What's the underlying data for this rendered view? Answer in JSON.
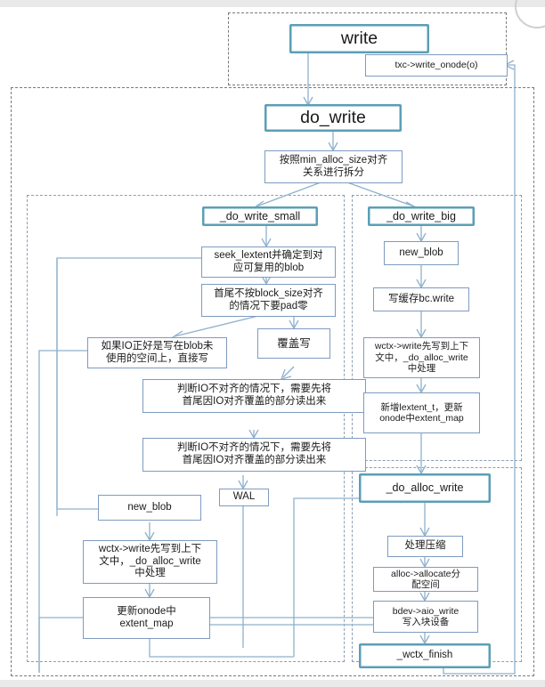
{
  "diagram": {
    "title_nodes": {
      "write": "write",
      "do_write": "do_write",
      "do_write_small": "_do_write_small",
      "do_write_big": "_do_write_big",
      "do_alloc_write": "_do_alloc_write",
      "wctx_finish": "_wctx_finish"
    },
    "nodes": {
      "write": "write",
      "txc_write_onode": "txc->write_onode(o)",
      "do_write": "do_write",
      "split": "按照min_alloc_size对齐\n关系进行拆分",
      "split_l1": "按照min_alloc_size对齐",
      "split_l2": "关系进行拆分",
      "do_write_small": "_do_write_small",
      "seek_lextent_l1": "seek_lextent并确定到对",
      "seek_lextent_l2": "应可复用的blob",
      "pad_zero_l1": "首尾不按block_size对齐",
      "pad_zero_l2": "的情况下要pad零",
      "unused_space_l1": "如果IO正好是写在blob未",
      "unused_space_l2": "使用的空间上，直接写",
      "overwrite": "覆盖写",
      "unaligned_a_l1": "判断IO不对齐的情况下，需要先将",
      "unaligned_a_l2": "首尾因IO对齐覆盖的部分读出来",
      "unaligned_b_l1": "判断IO不对齐的情况下，需要先将",
      "unaligned_b_l2": "首尾因IO对齐覆盖的部分读出来",
      "new_blob_small": "new_blob",
      "wal": "WAL",
      "wctx_write_small_l1": "wctx->write先写到上下",
      "wctx_write_small_l2": "文中，_do_alloc_write",
      "wctx_write_small_l3": "中处理",
      "update_onode_l1": "更新onode中",
      "update_onode_l2": "extent_map",
      "do_write_big": "_do_write_big",
      "new_blob_big": "new_blob",
      "bc_write": "写缓存bc.write",
      "wctx_write_big_l1": "wctx->write先写到上下",
      "wctx_write_big_l2": "文中，_do_alloc_write",
      "wctx_write_big_l3": "中处理",
      "new_lextent_l1": "新增lextent_t，更新",
      "new_lextent_l2": "onode中extent_map",
      "do_alloc_write": "_do_alloc_write",
      "compress": "处理压缩",
      "allocate_l1": "alloc->allocate分",
      "allocate_l2": "配空间",
      "aio_write_l1": "bdev->aio_write",
      "aio_write_l2": "写入块设备",
      "wctx_finish": "_wctx_finish"
    },
    "colors": {
      "accent_border": "#5b9fb5",
      "node_border": "#7f9bbf",
      "connector": "#8fb0cc",
      "group_border": "#7a7a7a",
      "inner_group_border": "#8a9fb5",
      "node_fill": "#ffffff",
      "page_bg": "#ffffff"
    }
  }
}
